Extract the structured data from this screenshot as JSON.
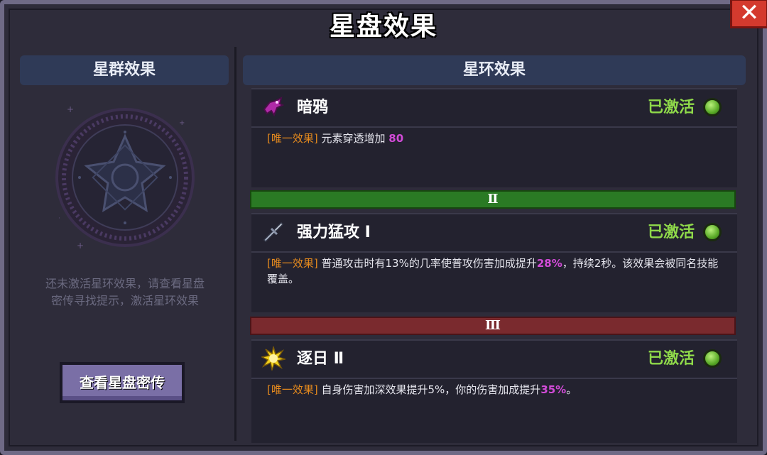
{
  "window": {
    "title": "星盘效果",
    "close_label": "✕"
  },
  "left": {
    "header": "星群效果",
    "hint_line1": "还未激活星环效果，请查看星盘",
    "hint_line2": "密传寻找提示，激活星环效果",
    "button": "查看星盘密传"
  },
  "right": {
    "header": "星环效果",
    "effects": [
      {
        "name": "暗鸦",
        "icon": "raven-icon",
        "status": "已激活",
        "tag": "[唯一效果]",
        "desc_before": "元素穿透增加",
        "highlight": "80",
        "desc_after": ""
      },
      {
        "name": "强力猛攻 Ⅰ",
        "icon": "sword-icon",
        "status": "已激活",
        "tag": "[唯一效果]",
        "desc_before": "普通攻击时有13%的几率使普攻伤害加成提升",
        "highlight": "28%",
        "desc_after": "，持续2秒。该效果会被同名技能覆盖。"
      },
      {
        "name": "逐日 Ⅱ",
        "icon": "sun-icon",
        "status": "已激活",
        "tag": "[唯一效果]",
        "desc_before": "自身伤害加深效果提升5%，你的伤害加成提升",
        "highlight": "35%",
        "desc_after": "。"
      }
    ],
    "tiers": [
      "Ⅱ",
      "Ⅲ"
    ]
  },
  "colors": {
    "active_green": "#8fd94a",
    "tag_orange": "#e58a1e",
    "highlight_purple": "#d24bd8",
    "tier2": "#2a7a24",
    "tier3": "#7a2a2e"
  }
}
